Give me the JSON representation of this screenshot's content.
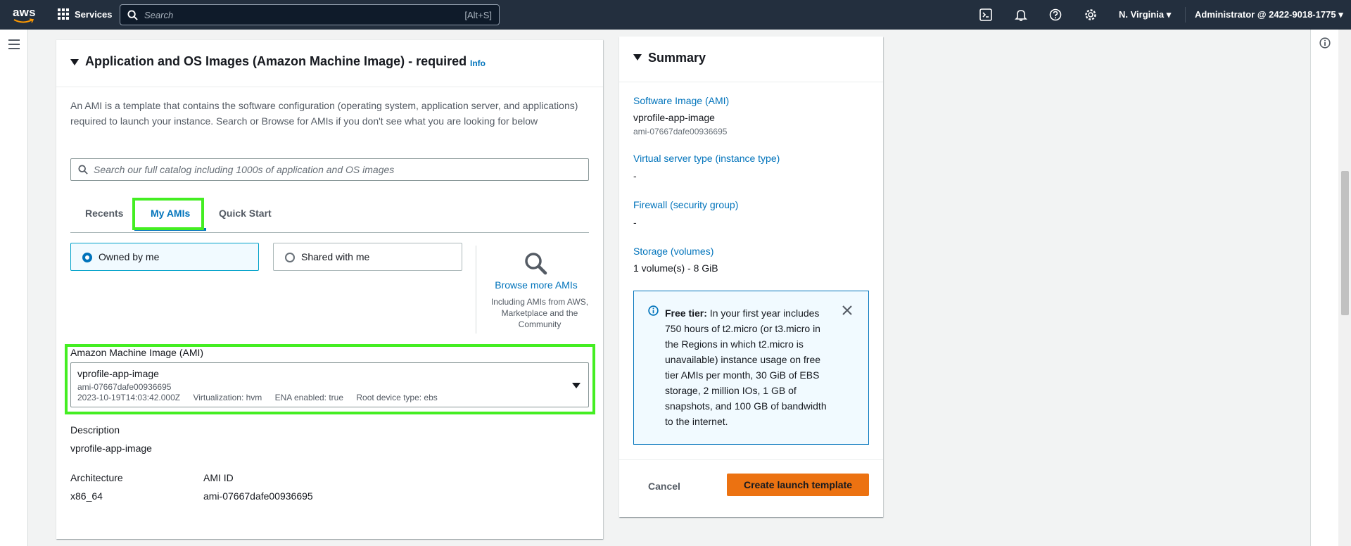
{
  "topnav": {
    "logo_text": "aws",
    "services_label": "Services",
    "search_placeholder": "Search",
    "search_shortcut": "[Alt+S]",
    "region": "N. Virginia",
    "account": "Administrator @ 2422-9018-1775"
  },
  "ami_section": {
    "title": "Application and OS Images (Amazon Machine Image) - required",
    "info_link": "Info",
    "description": "An AMI is a template that contains the software configuration (operating system, application server, and applications) required to launch your instance. Search or Browse for AMIs if you don't see what you are looking for below",
    "catalog_search_placeholder": "Search our full catalog including 1000s of application and OS images",
    "tabs": [
      {
        "label": "Recents",
        "active": false
      },
      {
        "label": "My AMIs",
        "active": true
      },
      {
        "label": "Quick Start",
        "active": false
      }
    ],
    "ownership_options": [
      {
        "label": "Owned by me",
        "selected": true
      },
      {
        "label": "Shared with me",
        "selected": false
      }
    ],
    "browse": {
      "link": "Browse more AMIs",
      "subtext": "Including AMIs from AWS, Marketplace and the Community"
    },
    "ami_select": {
      "label": "Amazon Machine Image (AMI)",
      "name": "vprofile-app-image",
      "id": "ami-07667dafe00936695",
      "date": "2023-10-19T14:03:42.000Z",
      "virtualization": "Virtualization: hvm",
      "ena": "ENA enabled: true",
      "root_device": "Root device type: ebs"
    },
    "description_label": "Description",
    "description_value": "vprofile-app-image",
    "architecture_label": "Architecture",
    "architecture_value": "x86_64",
    "ami_id_label": "AMI ID",
    "ami_id_value": "ami-07667dafe00936695"
  },
  "summary": {
    "title": "Summary",
    "software_image_label": "Software Image (AMI)",
    "software_image_value": "vprofile-app-image",
    "software_image_id": "ami-07667dafe00936695",
    "instance_type_label": "Virtual server type (instance type)",
    "instance_type_value": "-",
    "firewall_label": "Firewall (security group)",
    "firewall_value": "-",
    "storage_label": "Storage (volumes)",
    "storage_value": "1 volume(s) - 8 GiB",
    "free_tier_bold": "Free tier:",
    "free_tier_text": " In your first year includes 750 hours of t2.micro (or t3.micro in the Regions in which t2.micro is unavailable) instance usage on free tier AMIs per month, 30 GiB of EBS storage, 2 million IOs, 1 GB of snapshots, and 100 GB of bandwidth to the internet.",
    "cancel_label": "Cancel",
    "create_label": "Create launch template"
  },
  "colors": {
    "nav_bg": "#232f3e",
    "accent_link": "#0073bb",
    "primary_button": "#ec7211",
    "highlight": "#44ee22"
  }
}
